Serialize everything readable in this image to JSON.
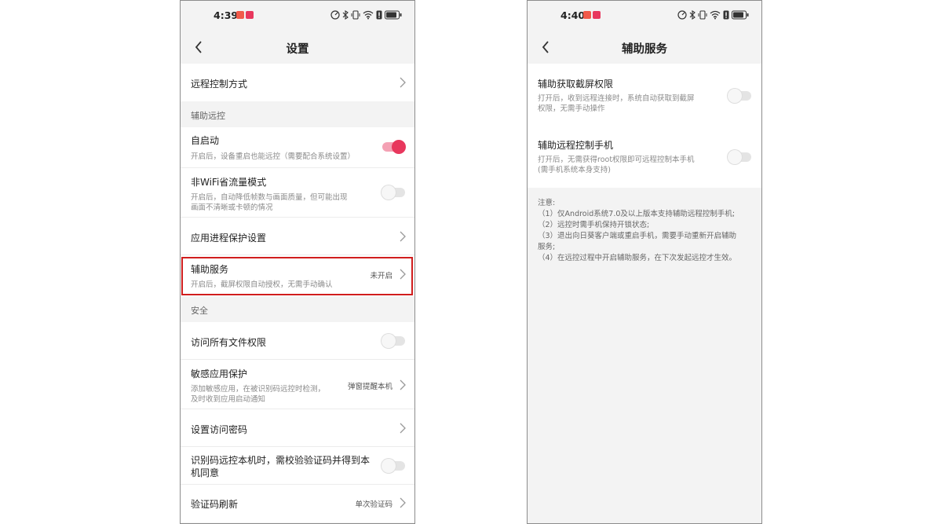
{
  "colors": {
    "accent": "#e8375d",
    "highlight_border": "#d01d1d",
    "background": "#f3f3f3"
  },
  "left_screen": {
    "status_bar": {
      "time": "4:39"
    },
    "title": "设置",
    "items": {
      "remote_control_mode": {
        "title": "远程控制方式"
      },
      "section_assist": "辅助远控",
      "auto_start": {
        "title": "自启动",
        "desc": "开启后，设备重启也能远控（需要配合系统设置）",
        "toggle_on": true
      },
      "non_wifi": {
        "title": "非WiFi省流量模式",
        "desc_line1": "开启后，自动降低帧数与画面质量，但可能出现",
        "desc_line2": "画面不清晰或卡顿的情况",
        "toggle_on": false
      },
      "process_protect": {
        "title": "应用进程保护设置"
      },
      "accessibility": {
        "title": "辅助服务",
        "desc": "开启后，截屏权限自动授权，无需手动确认",
        "value": "未开启"
      },
      "section_security": "安全",
      "file_access": {
        "title": "访问所有文件权限",
        "toggle_on": false
      },
      "sensitive_app": {
        "title": "敏感应用保护",
        "desc_line1": "添加敏感应用，在被识别码远控时检测，",
        "desc_line2": "及时收到应用启动通知",
        "value": "弹窗提醒本机"
      },
      "access_password": {
        "title": "设置访问密码"
      },
      "verify_code": {
        "title_line1": "识别码远控本机时，需校验验证码并得到本",
        "title_line2": "机同意",
        "toggle_on": false
      },
      "code_refresh": {
        "title": "验证码刷新",
        "value": "单次验证码"
      }
    }
  },
  "right_screen": {
    "status_bar": {
      "time": "4:40"
    },
    "title": "辅助服务",
    "items": {
      "screenshot_permission": {
        "title": "辅助获取截屏权限",
        "desc_line1": "打开后，收到远程连接时，系统自动获取到截屏",
        "desc_line2": "权限，无需手动操作",
        "toggle_on": false
      },
      "remote_control_phone": {
        "title": "辅助远程控制手机",
        "desc_line1": "打开后，无需获得root权限即可远程控制本手机",
        "desc_line2": "(需手机系统本身支持)",
        "toggle_on": false
      }
    },
    "notes": [
      "注意:",
      "（1）仅Android系统7.0及以上版本支持辅助远程控制手机;",
      "（2）远控时需手机保持开锁状态;",
      "（3）退出向日葵客户端或重启手机，需要手动重新开启辅助",
      "服务;",
      "（4）在远控过程中开启辅助服务，在下次发起远控才生效。"
    ]
  }
}
